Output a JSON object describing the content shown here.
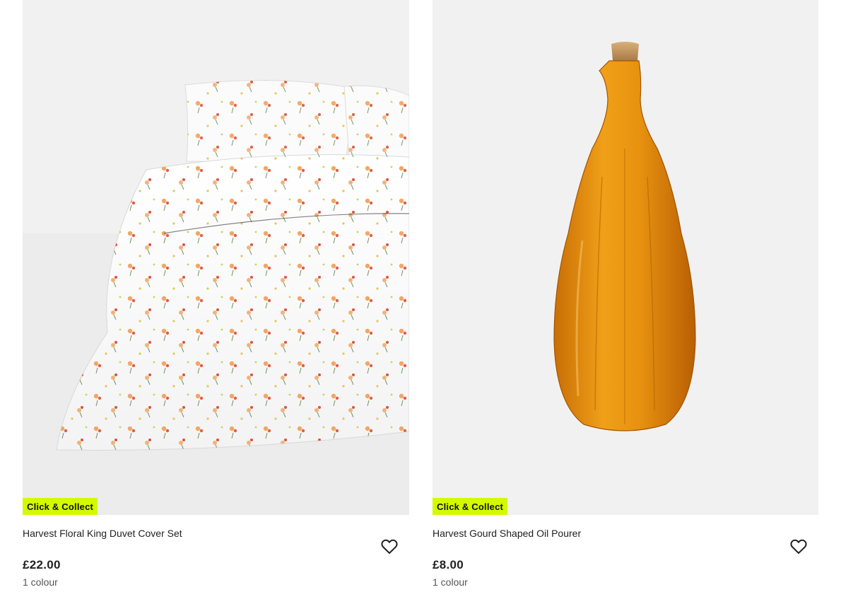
{
  "products": [
    {
      "badge": "Click & Collect",
      "name": "Harvest Floral King Duvet Cover Set",
      "price": "£22.00",
      "colours": "1 colour",
      "image_icon": "floral-duvet-image",
      "favourite_icon": "heart-outline-icon"
    },
    {
      "badge": "Click & Collect",
      "name": "Harvest Gourd Shaped Oil Pourer",
      "price": "£8.00",
      "colours": "1 colour",
      "image_icon": "amber-bottle-image",
      "favourite_icon": "heart-outline-icon"
    }
  ],
  "colors": {
    "badge_bg": "#d4f900",
    "image_bg": "#f1f1f1",
    "bottle_amber": "#e08a0c"
  }
}
